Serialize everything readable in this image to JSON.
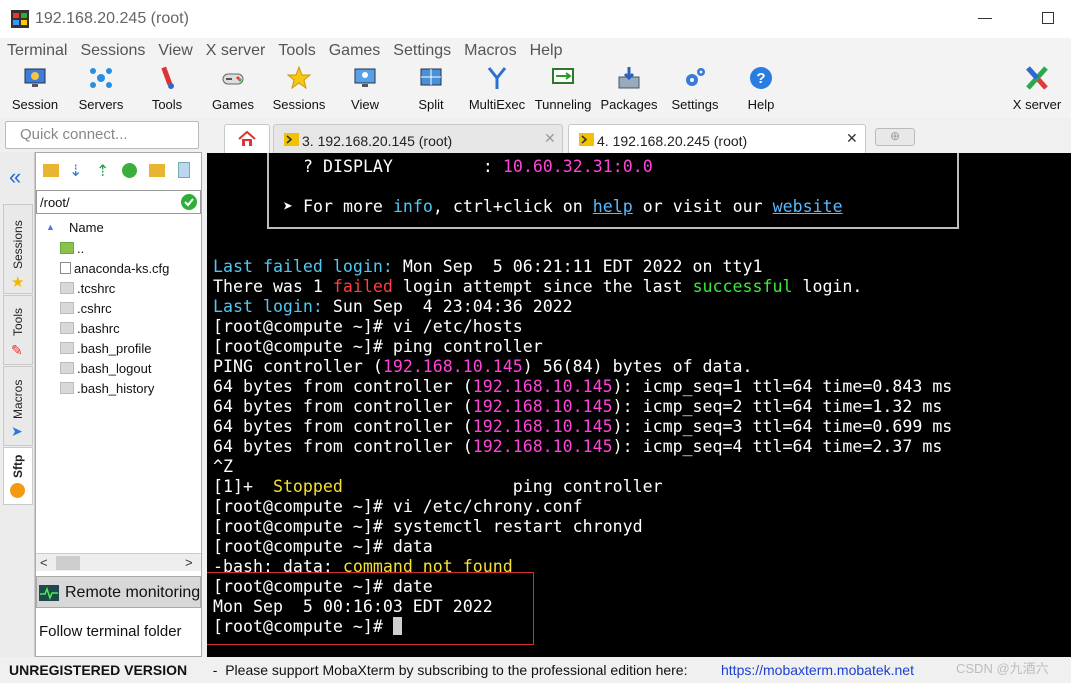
{
  "window": {
    "title": "192.168.20.245 (root)"
  },
  "menu": [
    "Terminal",
    "Sessions",
    "View",
    "X server",
    "Tools",
    "Games",
    "Settings",
    "Macros",
    "Help"
  ],
  "toolbar": {
    "session": "Session",
    "servers": "Servers",
    "tools": "Tools",
    "games": "Games",
    "sessions": "Sessions",
    "view": "View",
    "split": "Split",
    "multiexec": "MultiExec",
    "tunneling": "Tunneling",
    "packages": "Packages",
    "settings": "Settings",
    "help": "Help",
    "xserver": "X server"
  },
  "quick_connect": {
    "placeholder": "Quick connect..."
  },
  "tabs": [
    {
      "label": "3. 192.168.20.145 (root)"
    },
    {
      "label": "4. 192.168.20.245 (root)"
    }
  ],
  "sidebar_tabs": {
    "sessions": "Sessions",
    "tools": "Tools",
    "macros": "Macros",
    "sftp": "Sftp"
  },
  "sftp": {
    "path": "/root/",
    "column": "Name",
    "files": [
      "..",
      "anaconda-ks.cfg",
      ".tcshrc",
      ".cshrc",
      ".bashrc",
      ".bash_profile",
      ".bash_logout",
      ".bash_history"
    ],
    "remote_monitoring": "Remote monitoring",
    "follow_folder": "Follow terminal folder"
  },
  "terminal": {
    "display_label": "? DISPLAY",
    "display_sep": ":",
    "display_value": "10.60.32.31:0.0",
    "more_info": {
      "arrow": "➤",
      "p1": "For more",
      "info": "info",
      "p2": ", ctrl+click on",
      "help": "help",
      "p3": "or visit our",
      "website": "website"
    },
    "lines": {
      "last_failed_label": "Last failed login:",
      "last_failed_value": " Mon Sep  5 06:21:11 EDT 2022 on tty1",
      "there_was_1": "There was 1 ",
      "failed": "failed",
      "there_was_2": " login attempt since the last ",
      "successful": "successful",
      "there_was_3": " login.",
      "last_login_label": "Last login:",
      "last_login_value": " Sun Sep  4 23:04:36 2022",
      "cmd_vi_hosts": "[root@compute ~]# vi /etc/hosts",
      "cmd_ping": "[root@compute ~]# ping controller",
      "ping_head_1": "PING controller (",
      "ip": "192.168.10.145",
      "ping_head_2": ") 56(84) bytes of data.",
      "reply_prefix": "64 bytes from controller (",
      "reply_1": "): icmp_seq=1 ttl=64 time=0.843 ms",
      "reply_2": "): icmp_seq=2 ttl=64 time=1.32 ms",
      "reply_3": "): icmp_seq=3 ttl=64 time=0.699 ms",
      "reply_4": "): icmp_seq=4 ttl=64 time=2.37 ms",
      "ctrl_z": "^Z",
      "job_1": "[1]+  ",
      "stopped": "Stopped",
      "job_2": "                 ping controller",
      "cmd_vi_chrony": "[root@compute ~]# vi /etc/chrony.conf",
      "cmd_systemctl": "[root@compute ~]# systemctl restart chronyd",
      "cmd_data": "[root@compute ~]# data",
      "bash_err_1": "-bash: data: ",
      "not_found": "command not found",
      "cmd_date": "[root@compute ~]# date",
      "date_output": "Mon Sep  5 00:16:03 EDT 2022",
      "prompt": "[root@compute ~]# "
    }
  },
  "status_bar": {
    "unregistered": "UNREGISTERED VERSION",
    "message": "  -  Please support MobaXterm by subscribing to the professional edition here:",
    "link": "https://mobaxterm.mobatek.net",
    "watermark": "CSDN @九酒六"
  }
}
